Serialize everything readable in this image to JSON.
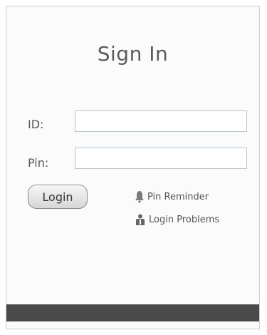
{
  "title": "Sign In",
  "form": {
    "id_label": "ID:",
    "pin_label": "Pin:",
    "id_value": "",
    "pin_value": ""
  },
  "actions": {
    "login_label": "Login",
    "pin_reminder_label": "Pin Reminder",
    "login_problems_label": "Login Problems"
  }
}
